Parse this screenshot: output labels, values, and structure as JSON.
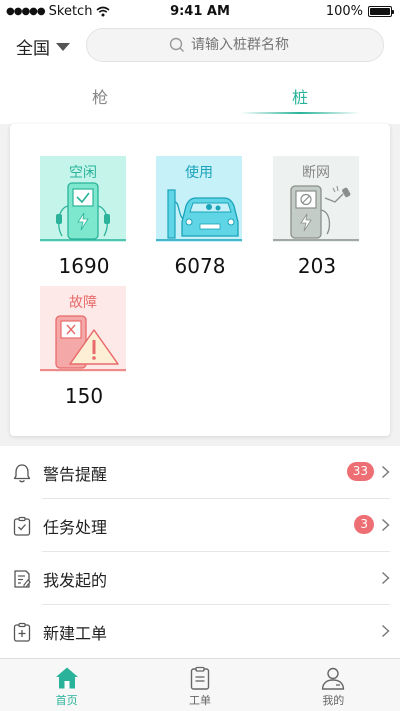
{
  "status_bar": {
    "carrier": "Sketch",
    "time": "9:41 AM",
    "battery": "100%"
  },
  "header": {
    "city": "全国",
    "search_placeholder": "请输入桩群名称",
    "tabs": [
      {
        "label": "枪"
      },
      {
        "label": "桩"
      }
    ],
    "active_tab": 1
  },
  "status_tiles": [
    {
      "label": "空闲",
      "count": "1690",
      "color": "#2ab39a"
    },
    {
      "label": "使用",
      "count": "6078",
      "color": "#1aa3b9"
    },
    {
      "label": "断网",
      "count": "203",
      "color": "#8a8f8c"
    },
    {
      "label": "故障",
      "count": "150",
      "color": "#e86a6a"
    }
  ],
  "menu": {
    "items": [
      {
        "label": "警告提醒",
        "badge": "33"
      },
      {
        "label": "任务处理",
        "badge": "3"
      },
      {
        "label": "我发起的"
      },
      {
        "label": "新建工单"
      }
    ]
  },
  "bottom_nav": {
    "items": [
      {
        "label": "首页"
      },
      {
        "label": "工单"
      },
      {
        "label": "我的"
      }
    ],
    "active": 0
  },
  "colors": {
    "accent": "#2ab39a",
    "badge": "#ee6f73"
  }
}
